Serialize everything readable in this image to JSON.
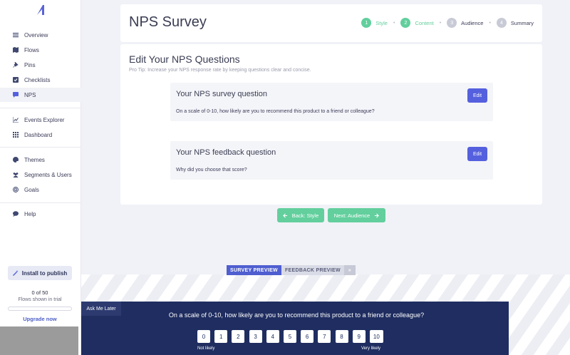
{
  "sidebar": {
    "logo": "appcues-logo",
    "groups": [
      [
        {
          "label": "Overview",
          "icon": "list-icon"
        },
        {
          "label": "Flows",
          "icon": "map-icon"
        },
        {
          "label": "Pins",
          "icon": "pin-icon"
        },
        {
          "label": "Checklists",
          "icon": "checklist-icon"
        },
        {
          "label": "NPS",
          "icon": "chat-icon",
          "active": true
        }
      ],
      [
        {
          "label": "Events Explorer",
          "icon": "chart-icon"
        },
        {
          "label": "Dashboard",
          "icon": "grid-icon"
        }
      ],
      [
        {
          "label": "Themes",
          "icon": "palette-icon"
        },
        {
          "label": "Segments & Users",
          "icon": "users-icon"
        },
        {
          "label": "Goals",
          "icon": "target-icon"
        }
      ],
      [
        {
          "label": "Help",
          "icon": "help-chat-icon"
        }
      ]
    ],
    "install_label": "Install to publish",
    "trial_count": "0 of 50",
    "trial_text": "Flows shown in trial",
    "trial_progress": 0,
    "upgrade_label": "Upgrade now"
  },
  "header": {
    "title": "NPS Survey",
    "steps": [
      {
        "num": "1",
        "label": "Style",
        "state": "done"
      },
      {
        "num": "2",
        "label": "Content",
        "state": "done"
      },
      {
        "num": "3",
        "label": "Audience",
        "state": "todo"
      },
      {
        "num": "4",
        "label": "Summary",
        "state": "todo"
      }
    ]
  },
  "main": {
    "section_title": "Edit Your NPS Questions",
    "pro_tip": "Pro Tip: Increase your NPS response rate by keeping questions clear and concise.",
    "questions": [
      {
        "title": "Your NPS survey question",
        "text": "On a scale of 0-10, how likely are you to recommend this product to a friend or colleague?",
        "edit_label": "Edit"
      },
      {
        "title": "Your NPS feedback question",
        "text": "Why did you choose that score?",
        "edit_label": "Edit"
      }
    ],
    "back_label": "Back: Style",
    "next_label": "Next: Audience"
  },
  "preview": {
    "tabs": {
      "survey": "SURVEY PREVIEW",
      "feedback": "FEEDBACK PREVIEW",
      "collapse": "»"
    },
    "ask_later": "Ask Me Later",
    "question": "On a scale of 0-10, how likely are you to recommend this product to a friend or colleague?",
    "scores": [
      "0",
      "1",
      "2",
      "3",
      "4",
      "5",
      "6",
      "7",
      "8",
      "9",
      "10"
    ],
    "low_label": "Not likely",
    "high_label": "Very likely"
  },
  "colors": {
    "accent": "#5560de",
    "success": "#62cf9d",
    "widget_bg": "#1f2d60",
    "background": "#f1f2f7"
  }
}
